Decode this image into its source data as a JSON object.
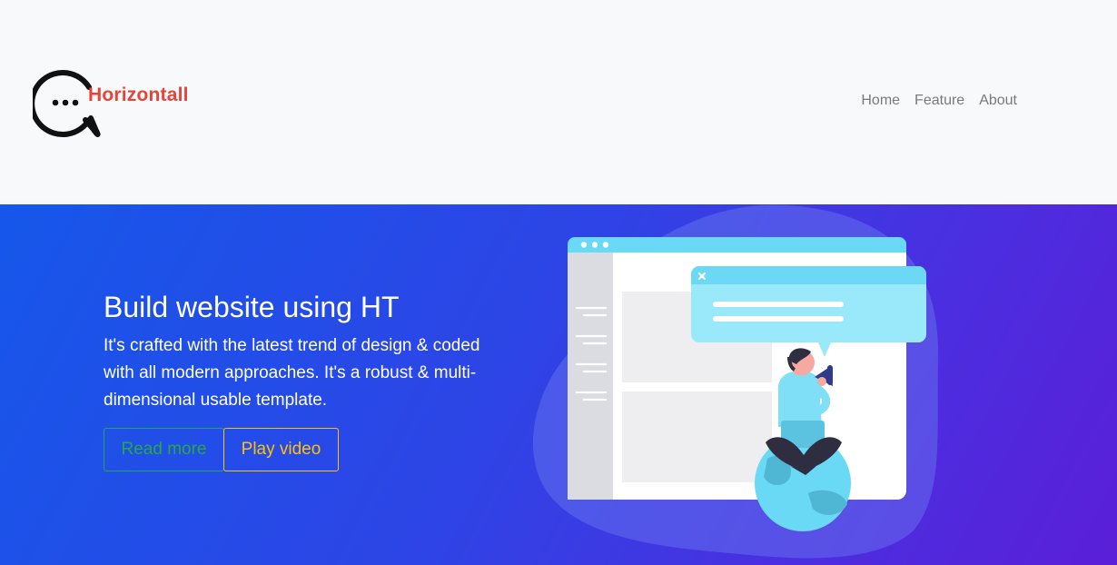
{
  "brand": {
    "name": "Horizontall",
    "logo_icon": "chat-bubble-icon"
  },
  "nav": {
    "items": [
      "Home",
      "Feature",
      "About"
    ]
  },
  "hero": {
    "title": "Build website using HT",
    "description": "It's crafted with the latest trend of design & coded with all modern approaches. It's a robust & multi-dimensional usable template.",
    "read_more": "Read more",
    "play_video": "Play video",
    "illustration_icon": "website-megaphone-illustration"
  },
  "colors": {
    "brand_red": "#e8433a",
    "hero_gradient_start": "#1657ea",
    "hero_gradient_end": "#5a1fd8",
    "read_more": "#28a745",
    "play_video": "#ffc107",
    "nav_link": "#7a7a7a"
  }
}
